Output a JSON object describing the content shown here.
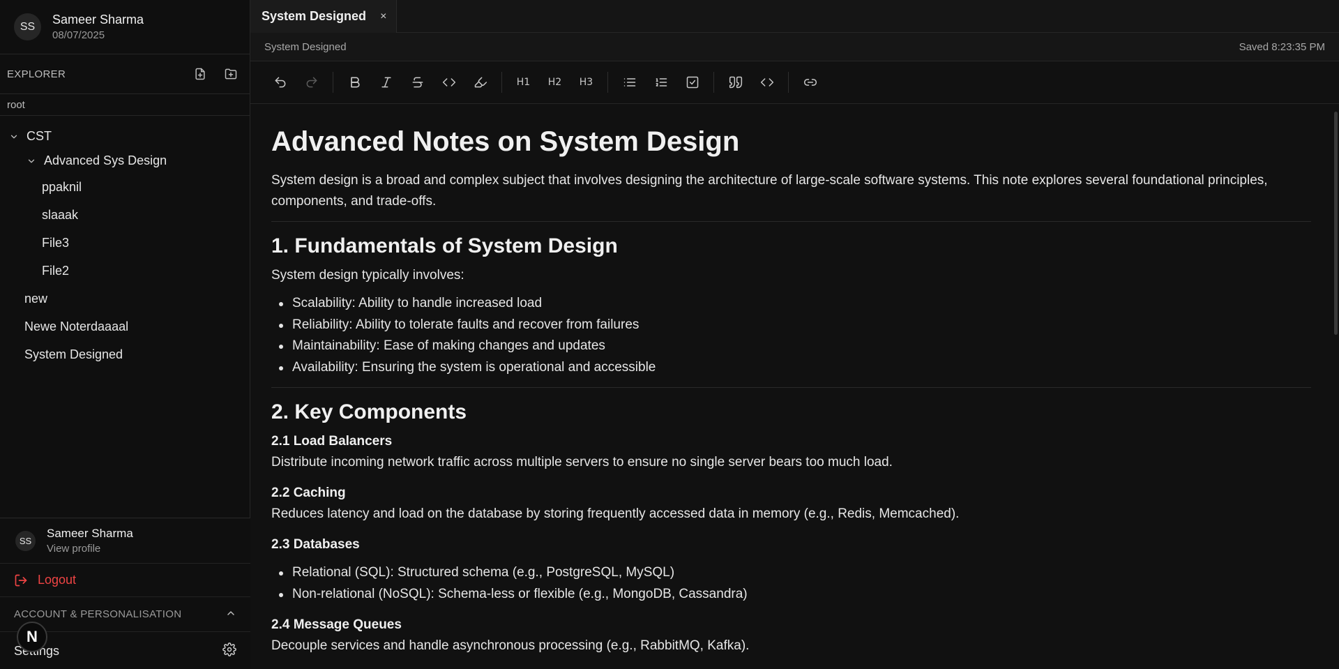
{
  "user": {
    "initials": "SS",
    "name": "Sameer Sharma",
    "date": "08/07/2025"
  },
  "explorer": {
    "title": "EXPLORER",
    "root": "root"
  },
  "tree": {
    "cst": "CST",
    "advanced": "Advanced Sys Design",
    "files": [
      "ppaknil",
      "slaaak",
      "File3",
      "File2"
    ],
    "top_files": [
      "new",
      "Newe Noterdaaaal",
      "System Designed"
    ]
  },
  "profile_menu": {
    "initials": "SS",
    "name": "Sameer Sharma",
    "view_profile": "View profile",
    "logout": "Logout",
    "account_section": "ACCOUNT & PERSONALISATION",
    "settings": "Settings",
    "badge": "N"
  },
  "tab": {
    "label": "System Designed",
    "close": "×"
  },
  "pathbar": {
    "crumb": "System Designed",
    "status": "Saved 8:23:35 PM"
  },
  "toolbar": {
    "h1": "H1",
    "h2": "H2",
    "h3": "H3"
  },
  "doc": {
    "title": "Advanced Notes on System Design",
    "intro": "System design is a broad and complex subject that involves designing the architecture of large-scale software systems. This note explores several foundational principles, components, and trade-offs.",
    "s1_heading": "1. Fundamentals of System Design",
    "s1_intro": "System design typically involves:",
    "s1_items": [
      "Scalability: Ability to handle increased load",
      "Reliability: Ability to tolerate faults and recover from failures",
      "Maintainability: Ease of making changes and updates",
      "Availability: Ensuring the system is operational and accessible"
    ],
    "s2_heading": "2. Key Components",
    "lb_heading": "2.1 Load Balancers",
    "lb_text": "Distribute incoming network traffic across multiple servers to ensure no single server bears too much load.",
    "cache_heading": "2.2 Caching",
    "cache_text": "Reduces latency and load on the database by storing frequently accessed data in memory (e.g., Redis, Memcached).",
    "db_heading": "2.3 Databases",
    "db_items": [
      "Relational (SQL): Structured schema (e.g., PostgreSQL, MySQL)",
      "Non-relational (NoSQL): Schema-less or flexible (e.g., MongoDB, Cassandra)"
    ],
    "mq_heading": "2.4 Message Queues",
    "mq_text": "Decouple services and handle asynchronous processing (e.g., RabbitMQ, Kafka)."
  },
  "colors": {
    "accent_danger": "#ef4444",
    "background": "#111111",
    "sidebar": "#0f0f0f"
  }
}
